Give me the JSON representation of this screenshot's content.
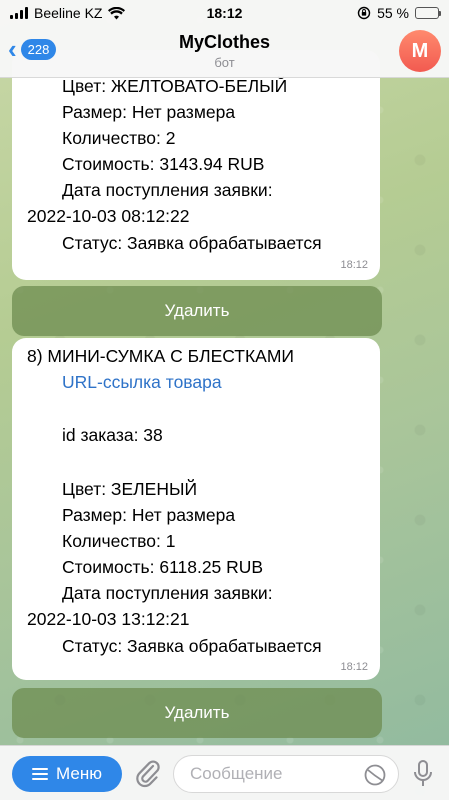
{
  "status_bar": {
    "carrier": "Beeline KZ",
    "time": "18:12",
    "battery_percent": "55 %",
    "battery_level": 0.55
  },
  "header": {
    "back_count": "228",
    "title": "MyClothes",
    "subtitle": "бот",
    "avatar_letter": "M"
  },
  "messages": [
    {
      "lines_top": [
        {
          "text": "Цвет: ЖЕЛТОВАТО-БЕЛЫЙ",
          "indent": true
        },
        {
          "text": "Размер: Нет размера",
          "indent": true
        },
        {
          "text": "Количество: 2",
          "indent": true
        },
        {
          "text": "Стоимость: 3143.94 RUB",
          "indent": true
        },
        {
          "text": "Дата поступления заявки:",
          "indent": true
        },
        {
          "text": "2022-10-03 08:12:22",
          "indent": false
        },
        {
          "text": "Статус: Заявка обрабатывается",
          "indent": true
        }
      ],
      "time": "18:12",
      "button_label": "Удалить"
    },
    {
      "title": "8) МИНИ-СУМКА С БЛЕСТКАМИ",
      "link": "URL-ссылка товара",
      "order_id": "id заказа: 38",
      "color": "Цвет: ЗЕЛЕНЫЙ",
      "size": "Размер: Нет размера",
      "quantity": "Количество: 1",
      "cost": "Стоимость: 6118.25 RUB",
      "date_label": "Дата поступления заявки:",
      "date_value": "2022-10-03 13:12:21",
      "status": "Статус: Заявка обрабатывается",
      "time": "18:12",
      "button_label": "Удалить"
    }
  ],
  "composer": {
    "menu_label": "Меню",
    "placeholder": "Сообщение"
  },
  "colors": {
    "accent": "#2f87e8",
    "link": "#2f73c8",
    "avatar": "#f25a50"
  },
  "icons": [
    "back-chevron-icon",
    "wifi-icon",
    "signal-icon",
    "rotation-lock-icon",
    "battery-icon",
    "menu-icon",
    "paperclip-icon",
    "sticker-icon",
    "microphone-icon"
  ]
}
